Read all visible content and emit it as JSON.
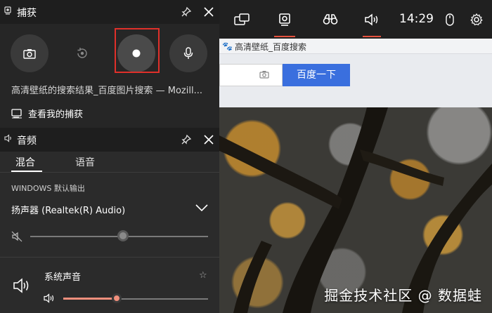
{
  "browser": {
    "tab_title": "高清壁纸_百度搜索",
    "search_button": "百度一下"
  },
  "watermark": "掘金技术社区 @ 数据蛙",
  "topbar": {
    "time": "14:29",
    "icons": [
      "widget-icon",
      "capture-icon",
      "binoculars-icon",
      "audio-icon",
      "mouse-icon",
      "gear-icon"
    ]
  },
  "capture": {
    "title": "捕获",
    "buttons": [
      "screenshot-button",
      "record-last-button",
      "record-button",
      "microphone-button"
    ],
    "window_title": "高清壁纸的搜索结果_百度图片搜索 — Mozill...",
    "view_captures": "查看我的捕获",
    "highlight_color": "#e0302a"
  },
  "audio": {
    "title": "音频",
    "tabs": [
      "混合",
      "语音"
    ],
    "active_tab": "混合",
    "output_label": "WINDOWS 默认输出",
    "device": "扬声器 (Realtek(R) Audio)",
    "master_volume": 0.52,
    "system_sound_label": "系统声音",
    "system_sound_volume": 0.37,
    "accent": "#f08f7c"
  }
}
